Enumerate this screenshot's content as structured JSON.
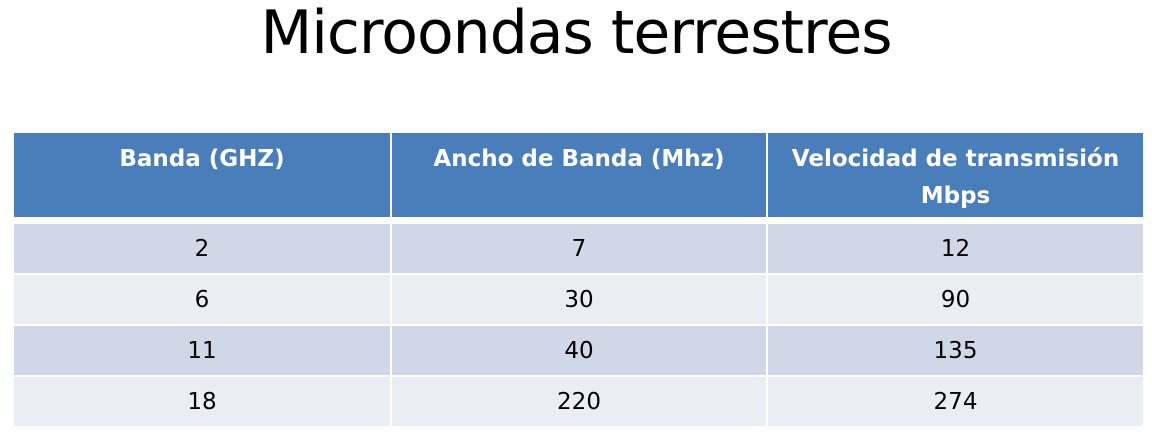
{
  "slide": {
    "title": "Microondas terrestres"
  },
  "table": {
    "headers": [
      "Banda (GHZ)",
      "Ancho de Banda (Mhz)",
      "Velocidad de transmisión Mbps"
    ],
    "rows": [
      [
        "2",
        "7",
        "12"
      ],
      [
        "6",
        "30",
        "90"
      ],
      [
        "11",
        "40",
        "135"
      ],
      [
        "18",
        "220",
        "274"
      ]
    ],
    "colors": {
      "header_background": "#4a7ebb",
      "header_text": "#ffffff",
      "row_band_dark": "#d0d8e8",
      "row_band_light": "#e9edf4"
    }
  }
}
